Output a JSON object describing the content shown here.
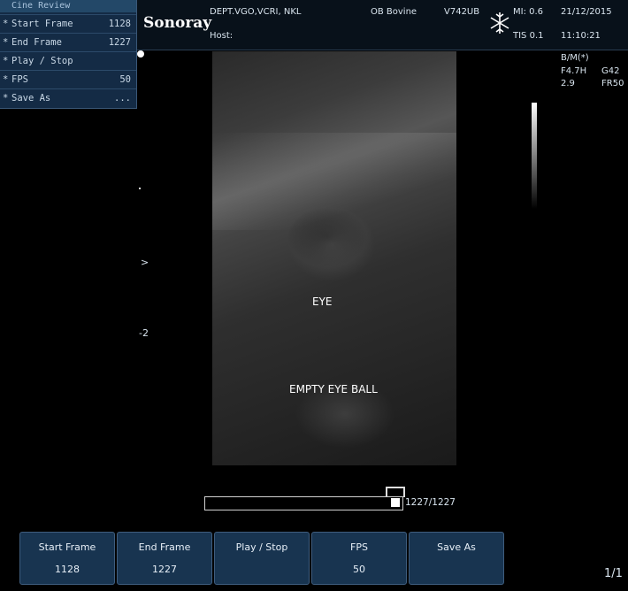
{
  "cine_menu": {
    "title": "Cine Review",
    "items": [
      {
        "label": "Start Frame",
        "value": "1128"
      },
      {
        "label": "End Frame",
        "value": "1227"
      },
      {
        "label": "Play / Stop",
        "value": ""
      },
      {
        "label": "FPS",
        "value": "50"
      },
      {
        "label": "Save As",
        "value": "..."
      }
    ]
  },
  "header": {
    "logo": "Sonoray",
    "department": "DEPT.VGO,VCRI, NKL",
    "host_label": "Host:",
    "preset": "OB Bovine",
    "probe": "V742UB",
    "mi": "MI: 0.6",
    "tis": "TIS 0.1",
    "date": "21/12/2015",
    "time": "11:10:21",
    "freeze_icon": "snowflake-icon"
  },
  "params": {
    "mode": "B/M(*)",
    "freq": "F4.7H",
    "gain": "G42",
    "depth_param": "2.9",
    "frame_rate": "FR50"
  },
  "depth_scale": {
    "marker_mid": ">",
    "label": "-2"
  },
  "annotations": {
    "eye": "EYE",
    "empty_eye_ball": "EMPTY EYE BALL"
  },
  "timeline": {
    "counter": "1227/1227",
    "progress_fraction": 1.0
  },
  "buttons": [
    {
      "title": "Start Frame",
      "value": "1128"
    },
    {
      "title": "End Frame",
      "value": "1227"
    },
    {
      "title": "Play / Stop",
      "value": ""
    },
    {
      "title": "FPS",
      "value": "50"
    },
    {
      "title": "Save As",
      "value": ""
    }
  ],
  "page_indicator": "1/1"
}
